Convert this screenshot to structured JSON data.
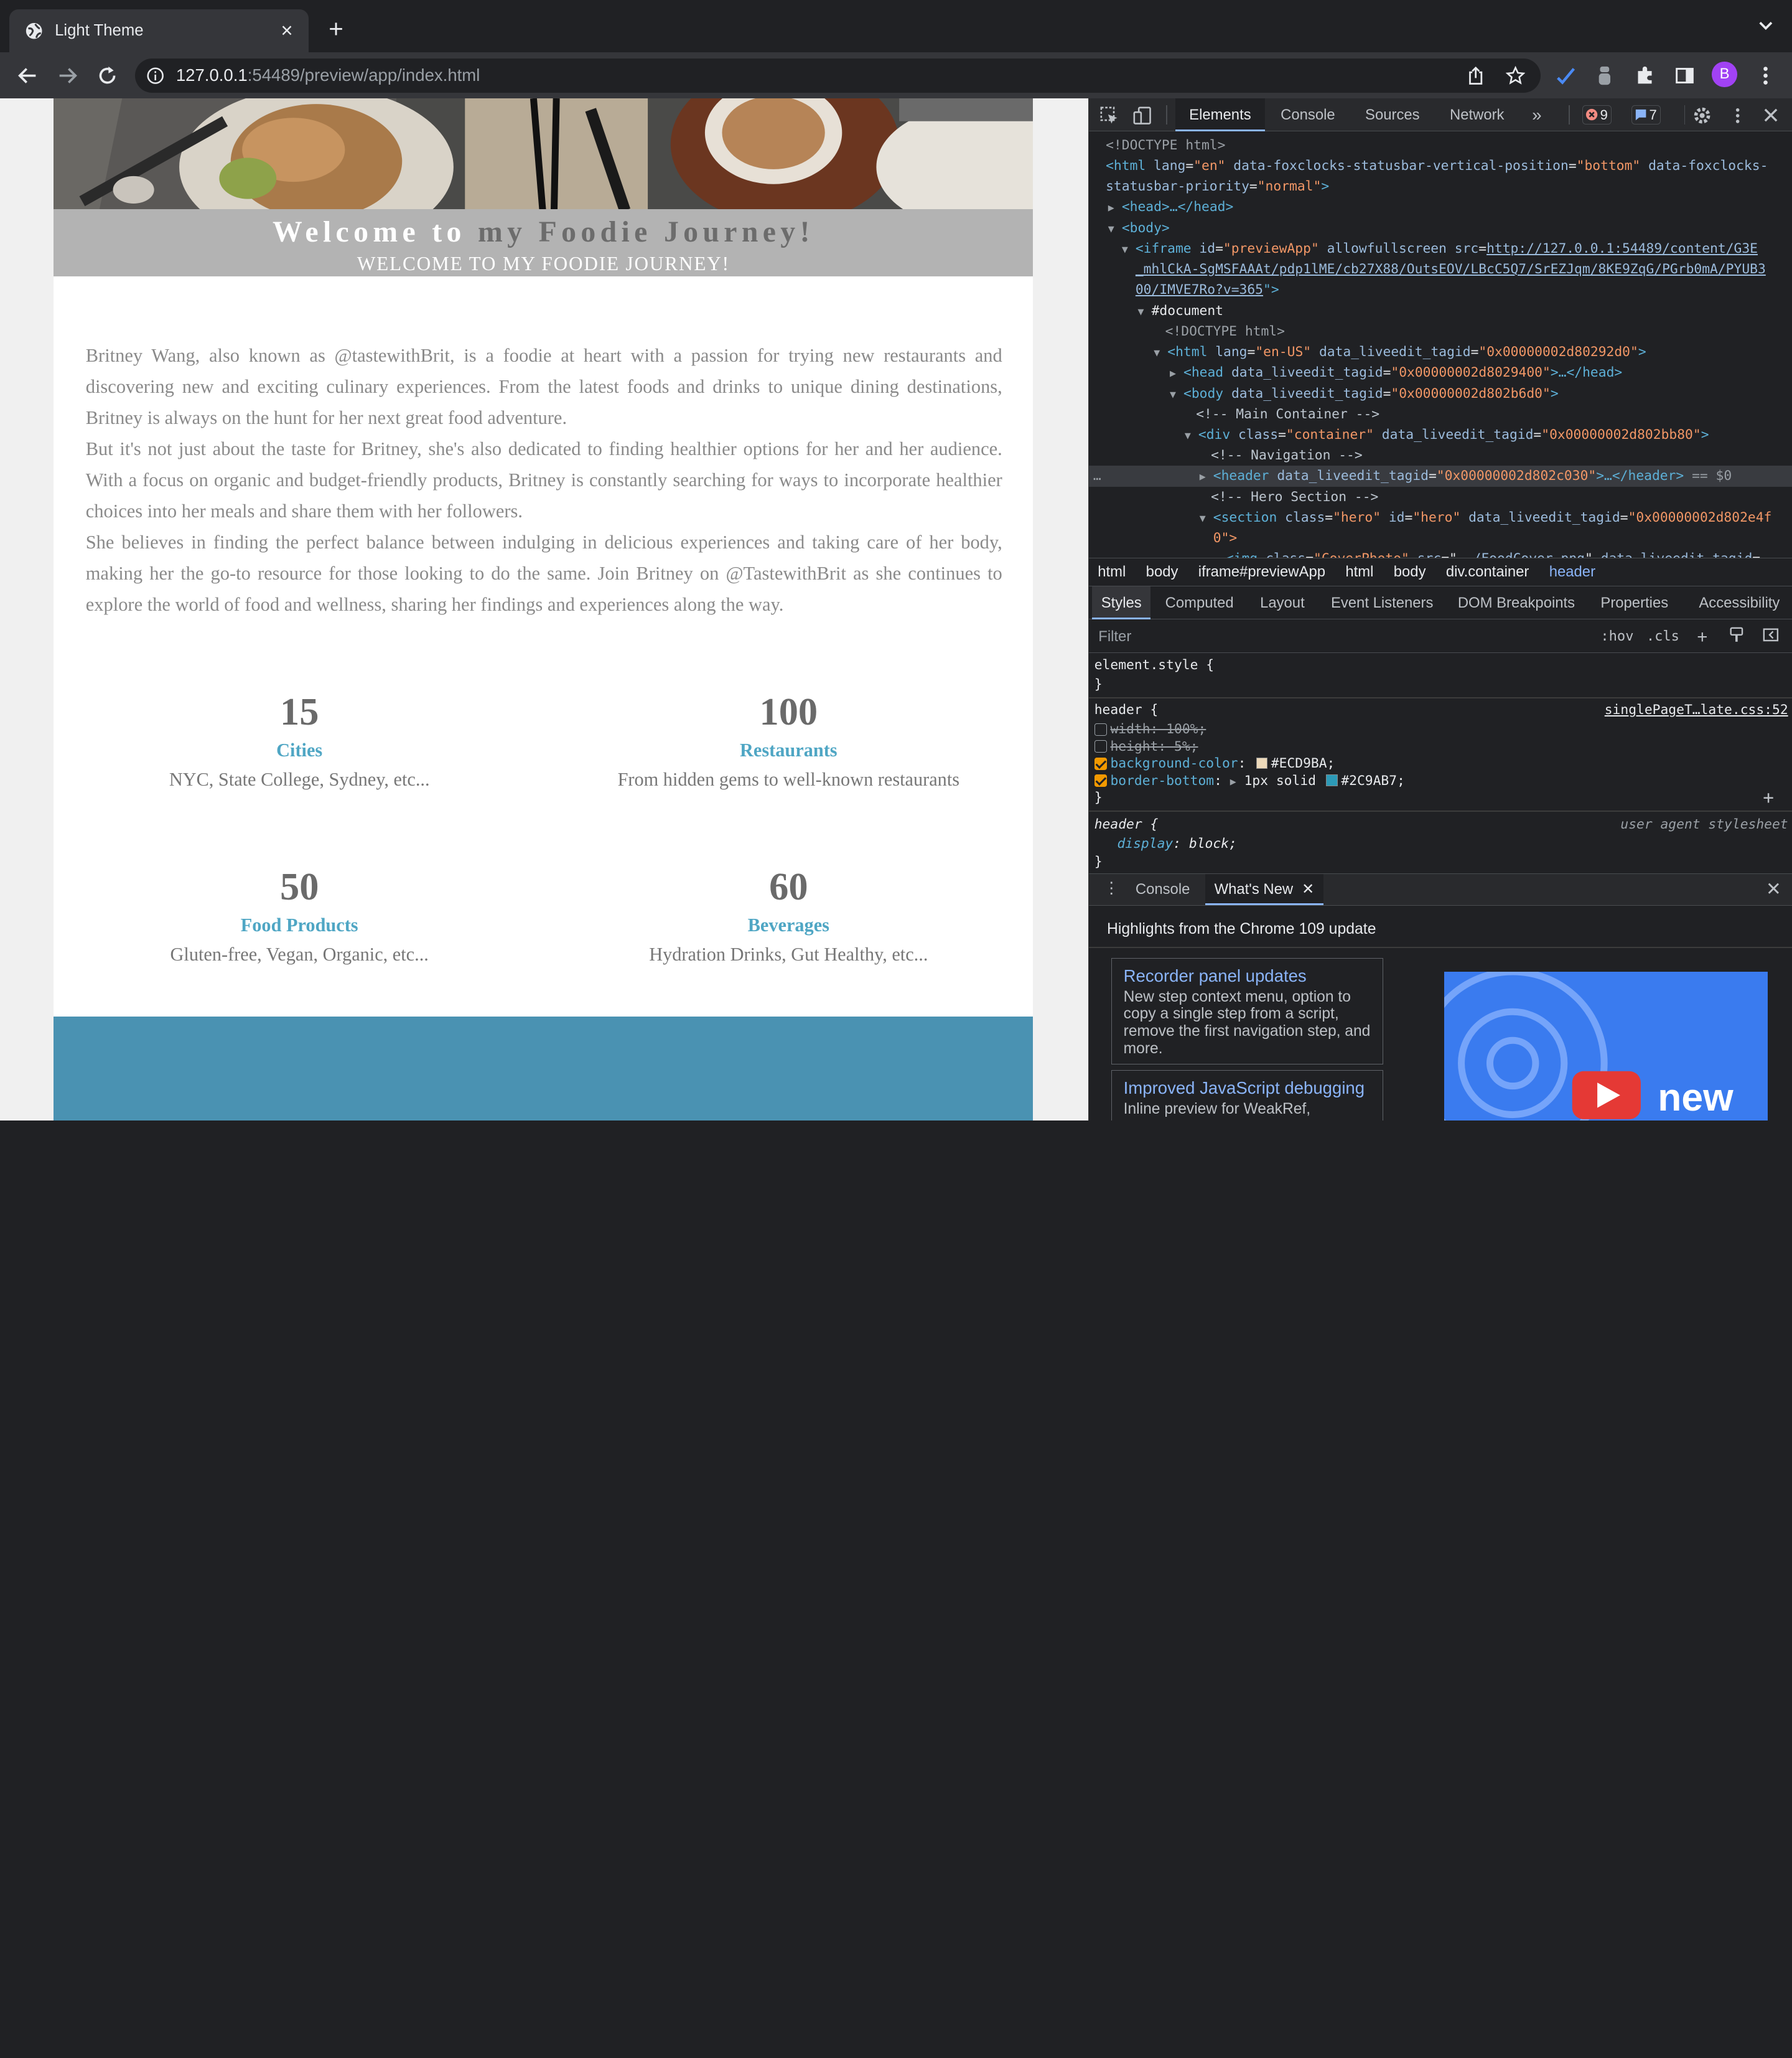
{
  "browser": {
    "tab_title": "Light Theme",
    "tab_close": "×",
    "new_tab": "+",
    "url_host": "127.0.0.1",
    "url_rest": ":54489/preview/app/index.html",
    "profile_initial": "B"
  },
  "page": {
    "hero_title_part1": "Welcome to ",
    "hero_title_part2": "my Foodie Journey!",
    "hero_subtitle": "WELCOME TO MY FOODIE JOURNEY!",
    "intro_paragraphs": [
      "Britney Wang, also known as @tastewithBrit, is a foodie at heart with a passion for trying new restaurants and discovering new and exciting culinary experiences. From the latest foods and drinks to unique dining destinations, Britney is always on the hunt for her next great food adventure.",
      "But it's not just about the taste for Britney, she's also dedicated to finding healthier options for her and her audience. With a focus on organic and budget-friendly products, Britney is constantly searching for ways to incorporate healthier choices into her meals and share them with her followers.",
      "She believes in finding the perfect balance between indulging in delicious experiences and taking care of her body, making her the go-to resource for those looking to do the same. Join Britney on @TastewithBrit as she continues to explore the world of food and wellness, sharing her findings and experiences along the way."
    ],
    "stats": [
      {
        "number": "15",
        "label": "Cities",
        "desc": "NYC, State College, Sydney, etc..."
      },
      {
        "number": "100",
        "label": "Restaurants",
        "desc": "From hidden gems to well-known restaurants"
      },
      {
        "number": "50",
        "label": "Food Products",
        "desc": "Gluten-free, Vegan, Organic, etc..."
      },
      {
        "number": "60",
        "label": "Beverages",
        "desc": "Hydration Drinks, Gut Healthy, etc..."
      }
    ]
  },
  "devtools": {
    "tabs": [
      "Elements",
      "Console",
      "Sources",
      "Network"
    ],
    "more_tabs": "»",
    "errors_count": "9",
    "messages_count": "7",
    "dom": {
      "l1": "<!DOCTYPE html>",
      "l2_attr1": "lang",
      "l2_val1": "\"en\"",
      "l2_attr2": "data-foxclocks-statusbar-vertical-position",
      "l2_val2": "\"bottom\"",
      "l2_attr3": "data-foxclocks-",
      "l3_attr": "statusbar-priority",
      "l3_val": "\"normal\"",
      "l4": "<head>…</head>",
      "l5": "<body>",
      "l6_attr1": "id",
      "l6_val1": "\"previewApp\"",
      "l6_attr2": "allowfullscreen",
      "l6_attr3": "src",
      "l6_link1": "http://127.0.0.1:54489/content/G3E",
      "l7_link": "_mhlCkA-SgMSFAAAt/pdp1lME/cb27X88/OutsEOV/LBcC5Q7/SrEZJqm/8KE9ZqG/PGrb0mA/PYUB3",
      "l8_link": "00/IMVE7Ro?v=365",
      "l9": "#document",
      "l10": "<!DOCTYPE html>",
      "l11_attr1": "lang",
      "l11_val1": "\"en-US\"",
      "l11_attr2": "data_liveedit_tagid",
      "l11_val2": "\"0x00000002d80292d0\"",
      "l12_val": "\"0x00000002d8029400\"",
      "l13_val": "\"0x00000002d802b6d0\"",
      "l14": "<!-- Main Container -->",
      "l15_val1": "\"container\"",
      "l15_val2": "\"0x00000002d802bb80\"",
      "l16": "<!-- Navigation -->",
      "l17_val": "\"0x00000002d802c030\"",
      "l17_suffix": "== $0",
      "l18": "<!-- Hero Section -->",
      "l19_val1": "\"hero\"",
      "l19_val2": "\"hero\"",
      "l19_val3": "\"0x00000002d802e4f",
      "l20": "0\">",
      "l21_val1": "\"CoverPhoto\"",
      "l21_link": "../FoodCover.png"
    },
    "breadcrumbs": [
      "html",
      "body",
      "iframe#previewApp",
      "html",
      "body",
      "div.container",
      "header"
    ],
    "style_tabs": [
      "Styles",
      "Computed",
      "Layout",
      "Event Listeners",
      "DOM Breakpoints",
      "Properties",
      "Accessibility"
    ],
    "filter_placeholder": "Filter",
    "hov": ":hov",
    "cls": ".cls",
    "rules": {
      "element_style": "element.style {",
      "header_selector": "header {",
      "header_source": "singlePageT…late.css:52",
      "width_decl": "width: 100%;",
      "height_decl": "height: 5%;",
      "bg_prop": "background-color",
      "bg_value": "#ECD9BA;",
      "bg_swatch": "#ECD9BA",
      "border_prop": "border-bottom",
      "border_value_pre": "1px solid",
      "border_value": "#2C9AB7;",
      "border_swatch": "#2C9AB7",
      "ua_selector": "header {",
      "ua_source": "user agent stylesheet",
      "display_decl": "display",
      "display_value": "block;",
      "close_brace": "}"
    },
    "drawer": {
      "console": "Console",
      "whats_new": "What's New",
      "highlights": "Highlights from the Chrome 109 update",
      "cards": [
        {
          "title": "Recorder panel updates",
          "body": "New step context menu, option to copy a single step from a script, remove the first navigation step, and more."
        },
        {
          "title": "Improved JavaScript debugging",
          "body": "Inline preview for WeakRef,"
        }
      ],
      "promo_text": "new"
    }
  }
}
